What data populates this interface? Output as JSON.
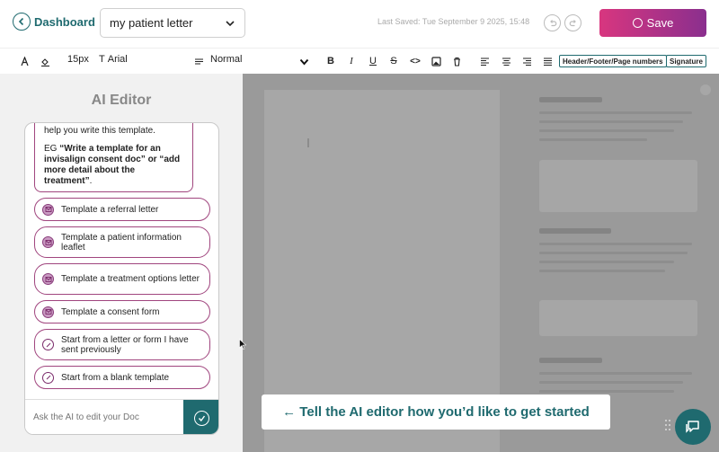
{
  "header": {
    "back_label": "Dashboard",
    "document_name": "my patient letter",
    "last_saved": "Last Saved: Tue September 9 2025, 15:48",
    "save_label": "Save"
  },
  "toolbar": {
    "font_size": "15px",
    "font_family": "Arial",
    "paragraph_style": "Normal",
    "bold": "B",
    "italic": "I",
    "underline": "U",
    "strike": "S",
    "code": "<>",
    "header_footer": "Header/Footer/Page numbers",
    "signature": "Signature"
  },
  "sidebar": {
    "title": "AI Editor",
    "intro_line": "help you write this template.",
    "example_prefix": "EG ",
    "example_bold": "“Write a template for an invisalign consent doc” or “add more detail about the treatment”",
    "example_suffix": ".",
    "suggestions": [
      "Template a referral letter",
      "Template a patient information leaflet",
      "Template a treatment options letter",
      "Template a consent form",
      "Start from a letter or form I have sent previously",
      "Start from a blank template"
    ],
    "input_placeholder": "Ask the AI to edit your Doc"
  },
  "tip_banner": "← Tell the AI editor how you’d like to get started",
  "colors": {
    "accent": "#1f6a6f",
    "save_gradient_start": "#d8367f",
    "save_gradient_end": "#8a2f8e",
    "suggestion_border": "#a0457e"
  }
}
